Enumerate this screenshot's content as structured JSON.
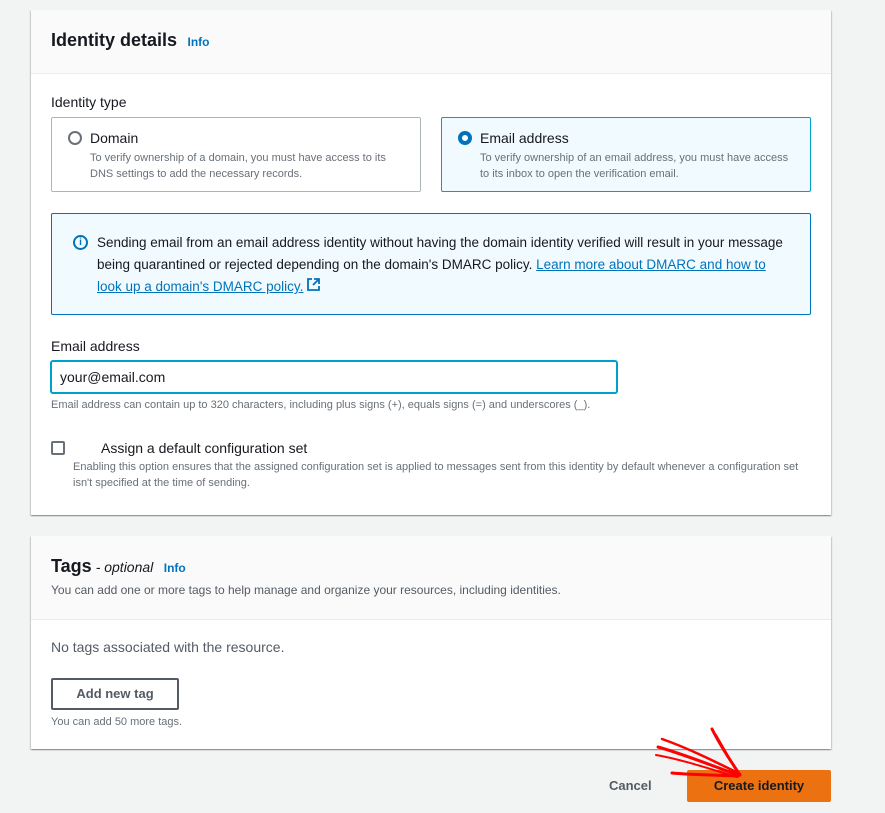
{
  "identity_details": {
    "title": "Identity details",
    "info_label": "Info",
    "identity_type_label": "Identity type",
    "options": [
      {
        "title": "Domain",
        "description": "To verify ownership of a domain, you must have access to its DNS settings to add the necessary records.",
        "selected": false
      },
      {
        "title": "Email address",
        "description": "To verify ownership of an email address, you must have access to its inbox to open the verification email.",
        "selected": true
      }
    ],
    "alert": {
      "text": "Sending email from an email address identity without having the domain identity verified will result in your message being quarantined or rejected depending on the domain's DMARC policy.",
      "link_text": "Learn more about DMARC and how to look up a domain's DMARC policy.",
      "icon": "info-circle-icon"
    },
    "email_field": {
      "label": "Email address",
      "value": "your@email.com",
      "hint": "Email address can contain up to 320 characters, including plus signs (+), equals signs (=) and underscores (_)."
    },
    "config_set": {
      "label": "Assign a default configuration set",
      "description": "Enabling this option ensures that the assigned configuration set is applied to messages sent from this identity by default whenever a configuration set isn't specified at the time of sending.",
      "checked": false
    }
  },
  "tags": {
    "title": "Tags",
    "optional_label": "- optional",
    "info_label": "Info",
    "description": "You can add one or more tags to help manage and organize your resources, including identities.",
    "empty_text": "No tags associated with the resource.",
    "add_button": "Add new tag",
    "limit_hint": "You can add 50 more tags."
  },
  "footer": {
    "cancel_label": "Cancel",
    "create_label": "Create identity"
  },
  "colors": {
    "primary_button": "#ec7211",
    "link": "#0073bb",
    "annotation": "#ff0000"
  }
}
